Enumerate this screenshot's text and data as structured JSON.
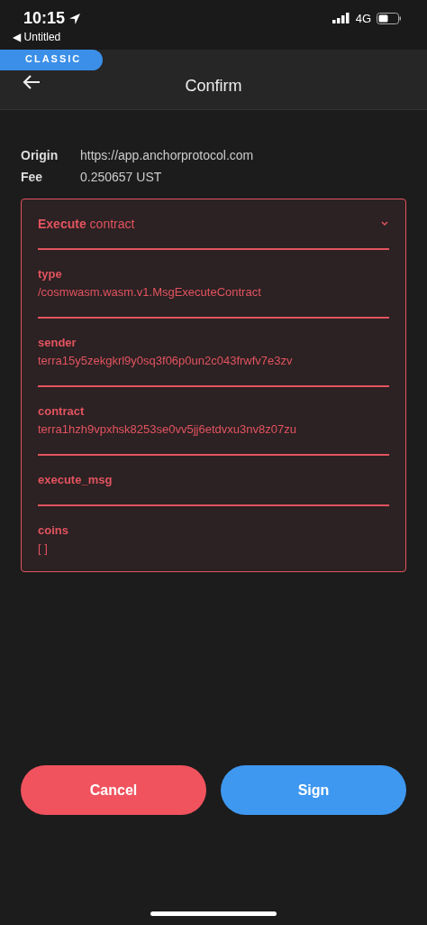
{
  "status_bar": {
    "time": "10:15",
    "back_app": "◀ Untitled",
    "network": "4G"
  },
  "header": {
    "badge": "CLASSIC",
    "title": "Confirm"
  },
  "summary": [
    {
      "label": "Origin",
      "value": "https://app.anchorprotocol.com"
    },
    {
      "label": "Fee",
      "value": "0.250657 UST"
    }
  ],
  "message": {
    "title": "**Execute** contract",
    "expanded": true,
    "fields": [
      {
        "label": "type",
        "value": "/cosmwasm.wasm.v1.MsgExecuteContract"
      },
      {
        "label": "sender",
        "value": "terra15y5zekgkrl9y0sq3f06p0un2c043frwfv7e3zv"
      },
      {
        "label": "contract",
        "value": "terra1hzh9vpxhsk8253se0vv5jj6etdvxu3nv8z07zu"
      },
      {
        "label": "execute_msg"
      },
      {
        "label": "coins",
        "value": "[ ]"
      }
    ]
  },
  "buttons": [
    {
      "label": "Cancel",
      "kind": "cancel"
    },
    {
      "label": "Sign",
      "kind": "confirm"
    }
  ]
}
